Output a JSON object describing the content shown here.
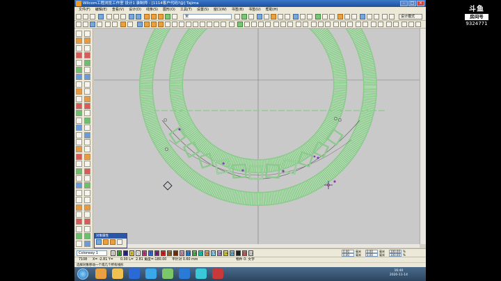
{
  "window": {
    "title": "Wilcom工程浏览工作室   设计1 录制师 - [1114客户代码?@]    Tajima"
  },
  "menu": [
    "文件(F)",
    "编辑(E)",
    "查看(V)",
    "设计(D)",
    "线条(S)",
    "图形(O)",
    "工具(T)",
    "设置(S)",
    "窗口(W)",
    "书签(B)",
    "书签(U)",
    "帮助(H)"
  ],
  "toolbar": {
    "font_combo": "宋",
    "design_mode": "设计模式"
  },
  "panel": {
    "title": "对象属性"
  },
  "colorway": {
    "label": "Colorway 1",
    "swatches": [
      {
        "n": "1",
        "c": "#e8e8e8"
      },
      {
        "n": "2",
        "c": "#3aa83a"
      },
      {
        "n": "3",
        "c": "#2a2a8a"
      },
      {
        "n": "4",
        "c": "#e8d840"
      },
      {
        "n": "5",
        "c": "#ffffff"
      },
      {
        "n": "6",
        "c": "#d83a8a"
      },
      {
        "n": "7",
        "c": "#3a6ad8"
      },
      {
        "n": "8",
        "c": "#8a2a8a"
      },
      {
        "n": "9",
        "c": "#d82a2a"
      },
      {
        "n": "10",
        "c": "#b07a30"
      },
      {
        "n": "11",
        "c": "#7a3a1a"
      },
      {
        "n": "12",
        "c": "#e8a0c8"
      },
      {
        "n": "13",
        "c": "#3a8ad8"
      },
      {
        "n": "14",
        "c": "#5ac85a"
      },
      {
        "n": "15",
        "c": "#2ad8c8"
      },
      {
        "n": "16",
        "c": "#f0b060"
      },
      {
        "n": "17",
        "c": "#a0e0ff"
      },
      {
        "n": "18",
        "c": "#c89ae8"
      },
      {
        "n": "19",
        "c": "#e8e060"
      },
      {
        "n": "20",
        "c": "#7ac8e8"
      },
      {
        "n": "21",
        "c": "#2a2a2a"
      },
      {
        "n": "22",
        "c": "#e86a6a"
      },
      {
        "n": "23",
        "c": "#eeeeee"
      }
    ],
    "fields": [
      "0.00",
      "0.00",
      "0.00",
      "100.00",
      "0.00",
      "100.00"
    ],
    "field_units": [
      "毫米",
      "毫米",
      "毫米",
      "%",
      "毫米",
      "%"
    ]
  },
  "status": {
    "stitches": "7108",
    "x": "X=  -2.81 Y=",
    "y": "0.00 L=",
    "l": "2.81  角度=-180.00",
    "spacing": "平针对  0.60 mm",
    "object": "物件 0: 文字"
  },
  "hint": "选择对象移动一个或几个所有线形",
  "taskbar": {
    "time": "16:40",
    "date": "2020-11-14"
  },
  "badge": {
    "logo": "斗鱼",
    "sub": "房间号",
    "room": "9324771"
  },
  "colors": {
    "stitch_green": "#8cc98c",
    "stitch_light": "#c8e6c8",
    "canvas": "#c9c9c9"
  }
}
